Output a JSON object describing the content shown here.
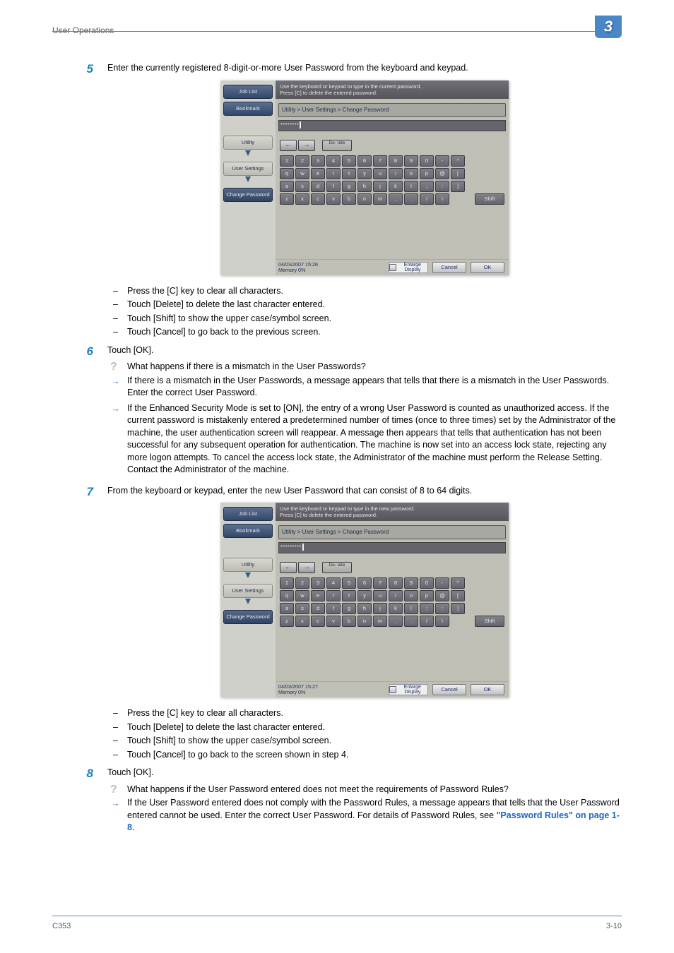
{
  "header": {
    "section_title": "User Operations",
    "chapter_number": "3"
  },
  "footer": {
    "model": "C353",
    "page": "3-10"
  },
  "link_text": "\"Password Rules\" on page 1-8",
  "steps": {
    "s5": {
      "num": "5",
      "text": "Enter the currently registered 8-digit-or-more User Password from the keyboard and keypad.",
      "bullets": [
        "Press the [C] key to clear all characters.",
        "Touch [Delete] to delete the last character entered.",
        "Touch [Shift] to show the upper case/symbol screen.",
        "Touch [Cancel] to go back to the previous screen."
      ]
    },
    "s6": {
      "num": "6",
      "text": "Touch [OK].",
      "q": "What happens if there is a mismatch in the User Passwords?",
      "a1": "If there is a mismatch in the User Passwords, a message appears that tells that there is a mismatch in the User Passwords. Enter the correct User Password.",
      "a2": "If the Enhanced Security Mode is set to [ON], the entry of a wrong User Password is counted as unauthorized access. If the current password is mistakenly entered a predetermined number of times (once to three times) set by the Administrator of the machine, the user authentication screen will reappear. A message then appears that tells that authentication has not been successful for any subsequent operation for authentication. The machine is now set into an access lock state, rejecting any more logon attempts. To cancel the access lock state, the Administrator of the machine must perform the Release Setting. Contact the Administrator of the machine."
    },
    "s7": {
      "num": "7",
      "text": "From the keyboard or keypad, enter the new User Password that can consist of 8 to 64 digits.",
      "bullets": [
        "Press the [C] key to clear all characters.",
        "Touch [Delete] to delete the last character entered.",
        "Touch [Shift] to show the upper case/symbol screen.",
        "Touch [Cancel] to go back to the screen shown in step 4."
      ]
    },
    "s8": {
      "num": "8",
      "text": "Touch [OK].",
      "q": "What happens if the User Password entered does not meet the requirements of Password Rules?",
      "a_before": "If the User Password entered does not comply with the Password Rules, a message appears that tells that the User Password entered cannot be used. Enter the correct User Password. For details of Password Rules, see ",
      "a_after": "."
    }
  },
  "shot1": {
    "prompt": "Use the keyboard or keypad to type in the current password.\nPress [C] to delete the entered password.",
    "breadcrumb": "Utility > User Settings > Change Password",
    "input": "********",
    "status_left": "04/03/2007   15:26\nMemory         0%",
    "enlarge": "Enlarge Display",
    "cancel": "Cancel",
    "ok": "OK"
  },
  "shot2": {
    "prompt": "Use the keyboard or keypad to type in the new password.\nPress [C] to delete the entered password.",
    "breadcrumb": "Utility > User Settings > Change Password",
    "input": "*********",
    "status_left": "04/03/2007   15:27\nMemory         0%",
    "enlarge": "Enlarge Display",
    "cancel": "Cancel",
    "ok": "OK"
  },
  "side": {
    "job": "Job List",
    "bm": "Bookmark",
    "util": "Utility",
    "user": "User Settings",
    "pwd": "Change Password"
  },
  "kb": {
    "del": "De-\nlete",
    "shift": "Shift",
    "row1": [
      "1",
      "2",
      "3",
      "4",
      "5",
      "6",
      "7",
      "8",
      "9",
      "0",
      "-",
      "^"
    ],
    "row2": [
      "q",
      "w",
      "e",
      "r",
      "t",
      "y",
      "u",
      "i",
      "o",
      "p",
      "@",
      "["
    ],
    "row3": [
      "a",
      "s",
      "d",
      "f",
      "g",
      "h",
      "j",
      "k",
      "l",
      ";",
      ":",
      "]"
    ],
    "row4": [
      "z",
      "x",
      "c",
      "v",
      "b",
      "n",
      "m",
      ",",
      ".",
      "/",
      "\\"
    ]
  }
}
